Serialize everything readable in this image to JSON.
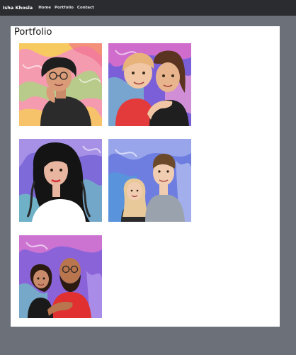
{
  "navbar": {
    "brand": "Isha Khosla",
    "links": [
      "Home",
      "Portfolio",
      "Contact"
    ]
  },
  "page": {
    "title": "Portfolio"
  },
  "gallery": [
    {
      "name": "portrait-woman-glasses",
      "palette": [
        "#f49bb0",
        "#f7d44e",
        "#9ee07c",
        "#f06a8a"
      ]
    },
    {
      "name": "portrait-two-women",
      "palette": [
        "#7a5fd9",
        "#e66fc8",
        "#74d3c9",
        "#f5a3d6"
      ]
    },
    {
      "name": "portrait-woman-long-hair",
      "palette": [
        "#7e6ad8",
        "#b9a2ee",
        "#6ad1c1",
        "#ffffff"
      ]
    },
    {
      "name": "portrait-couple",
      "palette": [
        "#6e7de0",
        "#a9b6ef",
        "#4aa1d8",
        "#c6cff3"
      ]
    },
    {
      "name": "portrait-father-child",
      "palette": [
        "#8b63d8",
        "#e87ad0",
        "#6ec7c3",
        "#b79ef0"
      ]
    }
  ]
}
